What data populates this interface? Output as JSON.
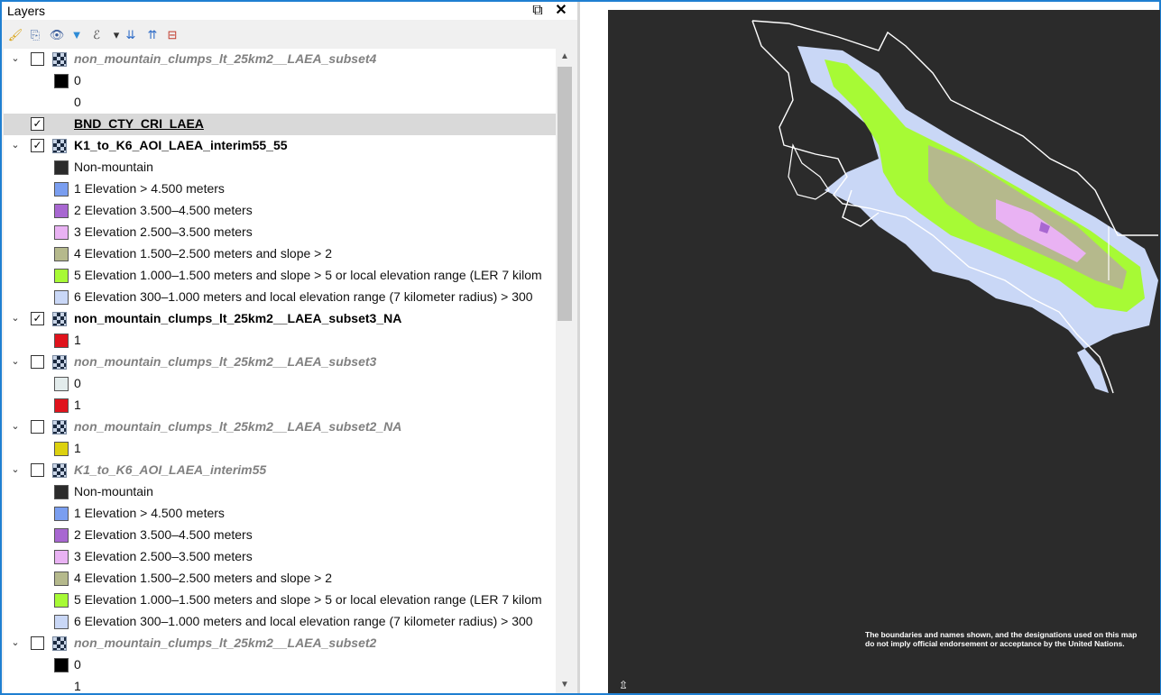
{
  "panel": {
    "title": "Layers",
    "float_glyph": "⧉",
    "close_glyph": "✕"
  },
  "toolbar": {
    "icons": [
      "style-icon",
      "add-group-icon",
      "visibility-icon",
      "filter-icon",
      "expression-filter-icon",
      "dropdown-icon",
      "expand-all-icon",
      "collapse-all-icon",
      "remove-layer-icon"
    ],
    "glyphs": [
      "🖌",
      "⎘",
      "👁",
      "▼",
      "ℰ",
      "▾",
      "⇊",
      "⇈",
      "⊟"
    ],
    "colors": [
      "#d9a10d",
      "#4a6ea8",
      "#3b5d9c",
      "#2e8bd6",
      "#444444",
      "#333333",
      "#2d6bc7",
      "#2d6bc7",
      "#c0392b"
    ]
  },
  "layers": {
    "rows": [
      {
        "type": "layer",
        "name": "non_mountain_clumps_lt_25km2__LAEA_subset4",
        "checked": false,
        "visible": false
      },
      {
        "type": "class",
        "label": "0",
        "color": "#000000"
      },
      {
        "type": "class",
        "label": "0",
        "color": null
      },
      {
        "type": "vector",
        "name": "BND_CTY_CRI_LAEA",
        "checked": true,
        "selected": true
      },
      {
        "type": "layer",
        "name": "K1_to_K6_AOI_LAEA_interim55_55",
        "checked": true,
        "visible": true
      },
      {
        "type": "class",
        "label": "Non-mountain",
        "color": "#2b2b2b"
      },
      {
        "type": "class",
        "label": "1 Elevation > 4.500 meters",
        "color": "#7a9ef0"
      },
      {
        "type": "class",
        "label": "2 Elevation 3.500–4.500 meters",
        "color": "#a867d1"
      },
      {
        "type": "class",
        "label": "3 Elevation 2.500–3.500 meters",
        "color": "#e9b2f3"
      },
      {
        "type": "class",
        "label": "4 Elevation 1.500–2.500 meters and slope > 2",
        "color": "#b5b98c"
      },
      {
        "type": "class",
        "label": "5 Elevation 1.000–1.500 meters and slope > 5 or local elevation range (LER 7 kilom",
        "color": "#a7fa35"
      },
      {
        "type": "class",
        "label": "6 Elevation 300–1.000 meters and local elevation range (7 kilometer radius) > 300",
        "color": "#c9d7f6"
      },
      {
        "type": "layer",
        "name": "non_mountain_clumps_lt_25km2__LAEA_subset3_NA",
        "checked": true,
        "visible": true
      },
      {
        "type": "class",
        "label": "1",
        "color": "#e0131c"
      },
      {
        "type": "layer",
        "name": "non_mountain_clumps_lt_25km2__LAEA_subset3",
        "checked": false,
        "visible": false
      },
      {
        "type": "class",
        "label": "0",
        "color": "#e3ecec"
      },
      {
        "type": "class",
        "label": "1",
        "color": "#e0131c"
      },
      {
        "type": "layer",
        "name": "non_mountain_clumps_lt_25km2__LAEA_subset2_NA",
        "checked": false,
        "visible": false
      },
      {
        "type": "class",
        "label": "1",
        "color": "#dcd10f"
      },
      {
        "type": "layer",
        "name": "K1_to_K6_AOI_LAEA_interim55",
        "checked": false,
        "visible": false
      },
      {
        "type": "class",
        "label": "Non-mountain",
        "color": "#2b2b2b"
      },
      {
        "type": "class",
        "label": "1 Elevation > 4.500 meters",
        "color": "#7a9ef0"
      },
      {
        "type": "class",
        "label": "2 Elevation 3.500–4.500 meters",
        "color": "#a867d1"
      },
      {
        "type": "class",
        "label": "3 Elevation 2.500–3.500 meters",
        "color": "#e9b2f3"
      },
      {
        "type": "class",
        "label": "4 Elevation 1.500–2.500 meters and slope > 2",
        "color": "#b5b98c"
      },
      {
        "type": "class",
        "label": "5 Elevation 1.000–1.500 meters and slope > 5 or local elevation range (LER 7 kilom",
        "color": "#a7fa35"
      },
      {
        "type": "class",
        "label": "6 Elevation 300–1.000 meters and local elevation range (7 kilometer radius) > 300",
        "color": "#c9d7f6"
      },
      {
        "type": "layer",
        "name": "non_mountain_clumps_lt_25km2__LAEA_subset2",
        "checked": false,
        "visible": false
      },
      {
        "type": "class",
        "label": "0",
        "color": "#000000"
      },
      {
        "type": "class",
        "label": "1",
        "color": null
      }
    ]
  },
  "map": {
    "background": "#2b2b2b",
    "disclaimer": "The boundaries and names shown, and the designations used on this map do not imply official endorsement or acceptance by the United Nations.",
    "north_glyph": "⇫",
    "class_colors": {
      "low": "#c9d7f6",
      "mid": "#a7fa35",
      "high": "#b5b98c",
      "higher": "#e9b2f3",
      "top": "#a867d1"
    }
  }
}
